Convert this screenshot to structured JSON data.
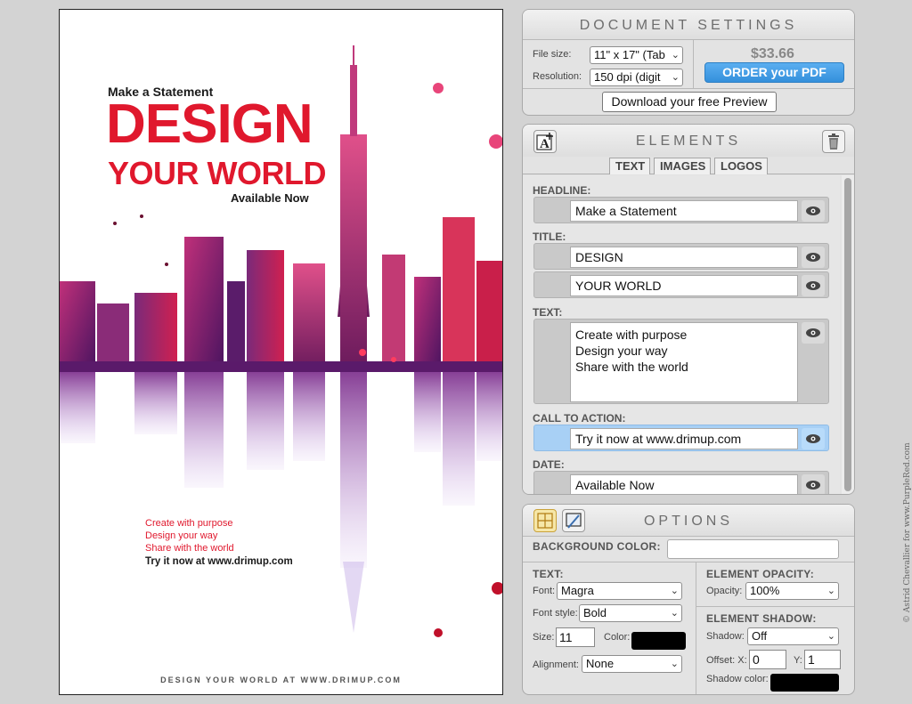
{
  "poster": {
    "headline": "Make a Statement",
    "title_line1": "DESIGN",
    "title_line2": "YOUR WORLD",
    "date": "Available Now",
    "text_lines": [
      "Create with purpose",
      "Design your way",
      "Share with the world"
    ],
    "call_to_action": "Try it now at www.drimup.com",
    "footer": "DESIGN YOUR WORLD AT WWW.DRIMUP.COM"
  },
  "document_settings": {
    "title": "DOCUMENT SETTINGS",
    "file_size_label": "File size:",
    "file_size_value": "11\" x 17\" (Tab",
    "resolution_label": "Resolution:",
    "resolution_value": "150 dpi (digit",
    "price": "$33.66",
    "order_button": "ORDER your PDF",
    "preview_button": "Download your free Preview"
  },
  "elements": {
    "title": "ELEMENTS",
    "tabs": [
      "TEXT",
      "IMAGES",
      "LOGOS"
    ],
    "headline_label": "HEADLINE:",
    "headline_value": "Make a Statement",
    "title_label": "TITLE:",
    "title_value1": "DESIGN",
    "title_value2": "YOUR WORLD",
    "text_label": "TEXT:",
    "text_lines": [
      "Create with purpose",
      "Design your way",
      "Share with the world"
    ],
    "cta_label": "CALL TO ACTION:",
    "cta_value": "Try it now at www.drimup.com",
    "date_label": "DATE:",
    "date_value": "Available Now"
  },
  "options": {
    "title": "OPTIONS",
    "bg_color_label": "BACKGROUND COLOR:",
    "bg_color": "#ffffff",
    "text_section": "TEXT:",
    "font_label": "Font:",
    "font_value": "Magra",
    "font_style_label": "Font style:",
    "font_style_value": "Bold",
    "size_label": "Size:",
    "size_value": "11",
    "color_label": "Color:",
    "text_color": "#000000",
    "alignment_label": "Alignment:",
    "alignment_value": "None",
    "opacity_section": "ELEMENT OPACITY:",
    "opacity_label": "Opacity:",
    "opacity_value": "100%",
    "shadow_section": "ELEMENT SHADOW:",
    "shadow_label": "Shadow:",
    "shadow_value": "Off",
    "offset_x_label": "Offset: X:",
    "offset_x_value": "0",
    "offset_y_label": "Y:",
    "offset_y_value": "1",
    "shadow_color_label": "Shadow color:",
    "shadow_color": "#000000"
  },
  "credit": "© Astrid Chevallier for www.PurpleRed.com",
  "colors": {
    "accent_red": "#e0182d",
    "order_blue": "#3a97e2"
  }
}
